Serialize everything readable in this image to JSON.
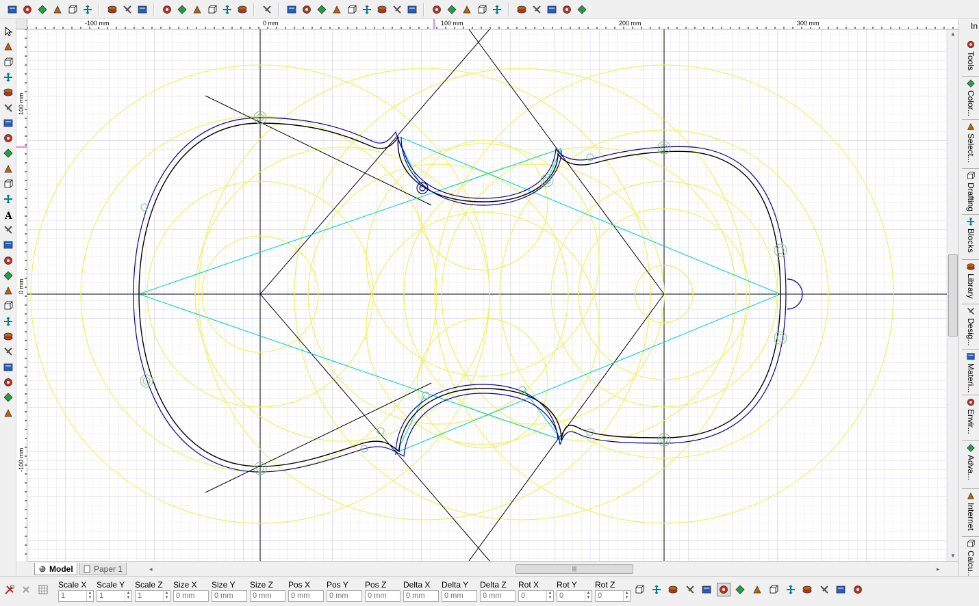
{
  "toolbar": {
    "icons": [
      "new-icon",
      "edit-icon",
      "open-icon",
      "save-icon",
      "save-as-icon",
      "print-icon",
      "help-icon",
      "context-help-icon",
      "lock-icon",
      "import-icon",
      "export-icon",
      "block-icon",
      "layer-icon",
      "paste-icon",
      "copy-icon",
      "render-icon",
      "view-front-icon",
      "view-back-icon",
      "view-top-icon",
      "view-bottom-icon",
      "view-left-icon",
      "view-right-icon",
      "view-iso-1-icon",
      "view-iso-2-icon",
      "view-iso-3-icon",
      "pan-icon",
      "move-icon",
      "rotate-view-icon",
      "zoom-icon",
      "undo-view-icon",
      "wireframe-icon",
      "shaded-icon",
      "hidden-line-icon",
      "solid-icon",
      "render-mode-icon"
    ]
  },
  "left_toolbar": {
    "icons": [
      "select-arrow-icon",
      "point-icon",
      "point-mode-icon",
      "line-icon",
      "double-line-icon",
      "hatch-icon",
      "circle-icon",
      "arc-icon",
      "curve-icon",
      "box-icon",
      "extrude-icon",
      "move-tool-icon",
      "text-icon",
      "color-fill-icon",
      "snap-icon",
      "layers-icon",
      "measure-icon",
      "dimension-icon",
      "trim-icon",
      "sphere-icon",
      "paint-icon",
      "boolean-icon",
      "group-icon",
      "ungroup-icon",
      "duplicate-icon",
      "explode-icon"
    ]
  },
  "ruler": {
    "h_labels": [
      "-100 mm",
      "0 mm",
      "100 mm",
      "200 mm",
      "300 mm"
    ],
    "v_labels": [
      "100 mm",
      "0 mm",
      "-100 mm"
    ]
  },
  "right_panel": {
    "top_label": "In",
    "tabs": [
      {
        "label": "Tools",
        "icon": "tools-icon"
      },
      {
        "label": "Color...",
        "icon": "color-palette-icon"
      },
      {
        "label": "Select...",
        "icon": "select-cursor-icon"
      },
      {
        "label": "Drafting",
        "icon": "drafting-icon"
      },
      {
        "label": "Blocks",
        "icon": "blocks-icon"
      },
      {
        "label": "Library",
        "icon": "library-icon"
      },
      {
        "label": "Desig...",
        "icon": "design-icon"
      },
      {
        "label": "Materi...",
        "icon": "materials-icon"
      },
      {
        "label": "Envir...",
        "icon": "environment-icon"
      },
      {
        "label": "Adva...",
        "icon": "advanced-icon"
      },
      {
        "label": "Internet",
        "icon": "internet-globe-icon"
      },
      {
        "label": "Calcu...",
        "icon": "calculator-icon"
      }
    ]
  },
  "tabs": {
    "model": "Model",
    "paper": "Paper 1"
  },
  "coords": [
    {
      "label": "Scale X",
      "value": "1",
      "spin": true
    },
    {
      "label": "Scale Y",
      "value": "1",
      "spin": true
    },
    {
      "label": "Scale Z",
      "value": "1",
      "spin": true
    },
    {
      "label": "Size X",
      "value": "0 mm",
      "spin": false
    },
    {
      "label": "Size Y",
      "value": "0 mm",
      "spin": false
    },
    {
      "label": "Size Z",
      "value": "0 mm",
      "spin": false
    },
    {
      "label": "Pos X",
      "value": "0 mm",
      "spin": false
    },
    {
      "label": "Pos Y",
      "value": "0 mm",
      "spin": false
    },
    {
      "label": "Pos Z",
      "value": "0 mm",
      "spin": false
    },
    {
      "label": "Delta X",
      "value": "0 mm",
      "spin": false
    },
    {
      "label": "Delta Y",
      "value": "0 mm",
      "spin": false
    },
    {
      "label": "Delta Z",
      "value": "0 mm",
      "spin": false
    },
    {
      "label": "Rot X",
      "value": "0",
      "spin": true
    },
    {
      "label": "Rot Y",
      "value": "0",
      "spin": true
    },
    {
      "label": "Rot Z",
      "value": "0",
      "spin": true
    }
  ],
  "status_icons": [
    "tools-cross-icon",
    "cancel-icon",
    "table-icon"
  ],
  "status_tools": [
    "group-objects-icon",
    "ungroup-icon",
    "edit-curve-icon",
    "warning-icon",
    "select-frame-icon",
    "bounding-box-icon",
    "crop-icon",
    "transform-icon",
    "scale-frame-icon",
    "skew-icon",
    "rotate-frame-icon",
    "stretch-icon",
    "bevel-icon",
    "perspective-icon"
  ],
  "colors": {
    "geometry_outline": "#000000",
    "offset_outline": "#0000a0",
    "construction_circles": "#f0f060",
    "guide_lines": "#00d0e0",
    "snap_marks": "#80c080",
    "grid": "#d8d8ec"
  }
}
